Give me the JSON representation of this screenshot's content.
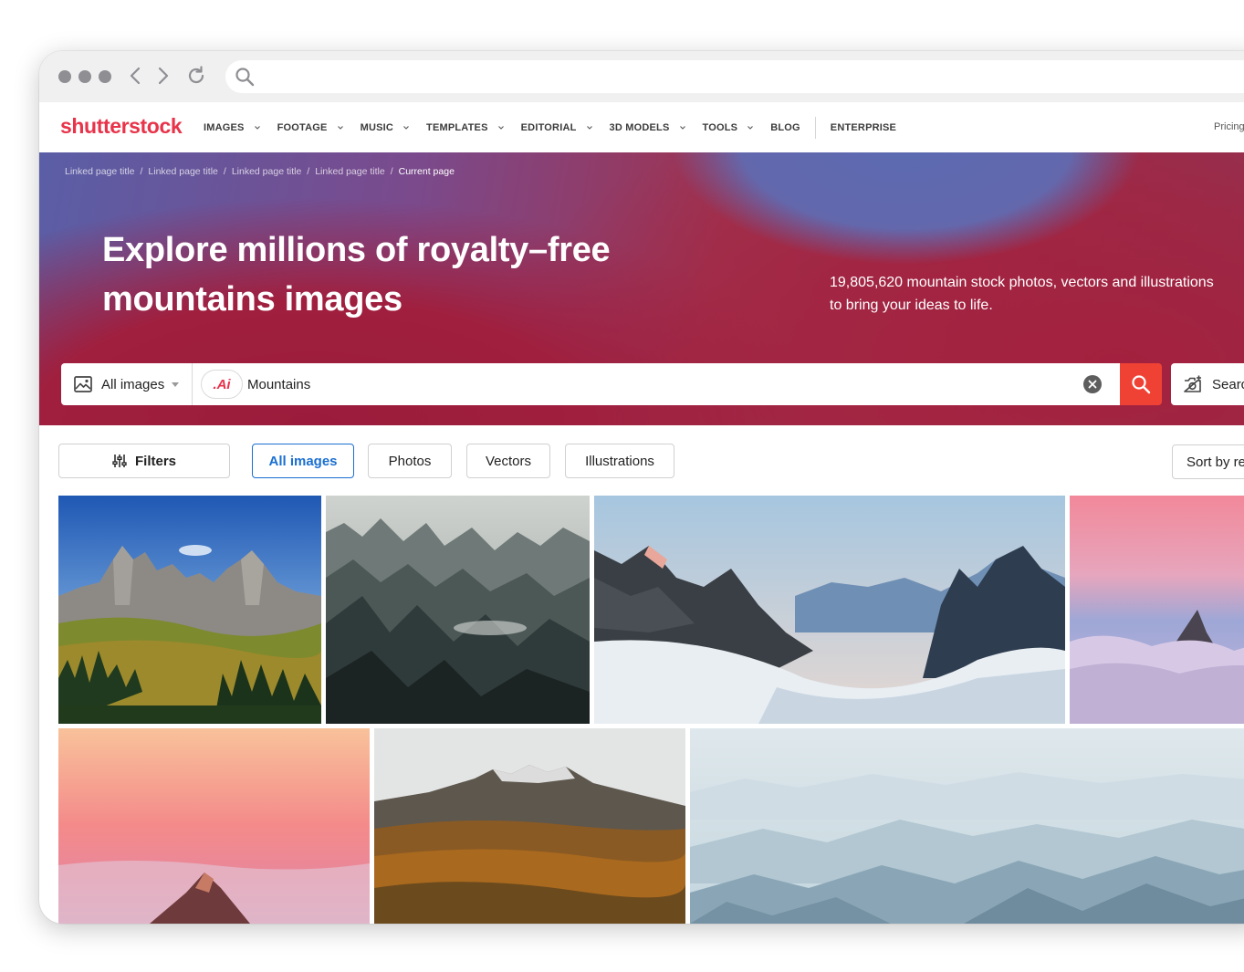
{
  "browser": {
    "url": ""
  },
  "header": {
    "logo": "shutterstock",
    "nav": [
      {
        "label": "IMAGES",
        "dropdown": true
      },
      {
        "label": "FOOTAGE",
        "dropdown": true
      },
      {
        "label": "MUSIC",
        "dropdown": true
      },
      {
        "label": "TEMPLATES",
        "dropdown": true
      },
      {
        "label": "EDITORIAL",
        "dropdown": true
      },
      {
        "label": "3D MODELS",
        "dropdown": true
      },
      {
        "label": "TOOLS",
        "dropdown": true
      },
      {
        "label": "BLOG",
        "dropdown": false
      },
      {
        "label": "ENTERPRISE",
        "dropdown": false
      }
    ],
    "pricing": "Pricing"
  },
  "hero": {
    "breadcrumbs": [
      "Linked page title",
      "Linked page title",
      "Linked page title",
      "Linked page title"
    ],
    "breadcrumb_current": "Current page",
    "title_line1": "Explore millions of royalty–free",
    "title_line2": "mountains images",
    "subtitle_line1": "19,805,620 mountain stock photos, vectors and illustrations",
    "subtitle_line2": "to bring your ideas to life."
  },
  "search": {
    "type_label": "All images",
    "ai_badge": ".Ai",
    "query": "Mountains",
    "image_search_label": "Search"
  },
  "filters": {
    "filters_label": "Filters",
    "types": [
      "All images",
      "Photos",
      "Vectors",
      "Illustrations"
    ],
    "active_type": "All images",
    "sort_label": "Sort by relevant"
  },
  "colors": {
    "brand": "#e8334a",
    "search_button": "#f04234",
    "active_filter": "#1a6fd1"
  }
}
